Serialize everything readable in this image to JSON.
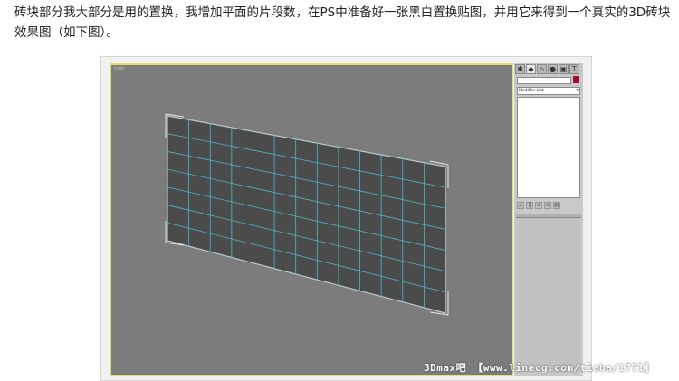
{
  "article": {
    "paragraph": "砖块部分我大部分是用的置换，我增加平面的片段数，在PS中准备好一张黑白置换贴图，并用它来得到一个真实的3D砖块效果图（如下图）。"
  },
  "viewport": {
    "label": "User",
    "border_color": "#e2e26a",
    "background": "#7c7c7c",
    "plane": {
      "rows": 7,
      "cols": 13,
      "fill": "#4b4b4b",
      "wire_color": "#4fb7c8"
    }
  },
  "command_panel": {
    "tabs": [
      {
        "icon": "create-icon"
      },
      {
        "icon": "modify-icon"
      },
      {
        "icon": "hierarchy-icon"
      },
      {
        "icon": "motion-icon"
      },
      {
        "icon": "display-icon"
      },
      {
        "icon": "utilities-icon"
      }
    ],
    "object_color": "#9c1030",
    "modifier_list_label": "Modifier List"
  },
  "watermark": "3Dmax吧 【www.linecg.com/tieba/1771】"
}
